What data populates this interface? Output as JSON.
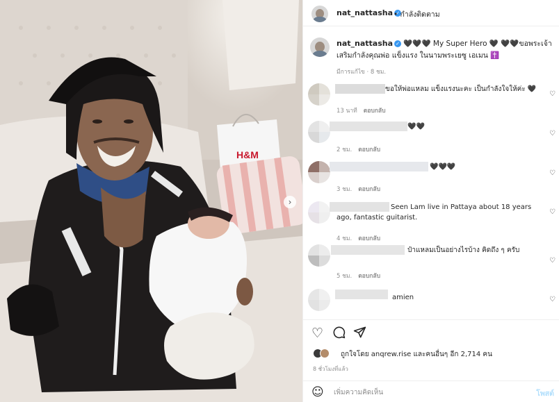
{
  "header": {
    "username": "nat_nattasha",
    "follow_status": "• กำลังติดตาม"
  },
  "caption": {
    "username": "nat_nattasha",
    "text": "🖤🖤🖤 My Super Hero 🖤 🖤🖤ขอพระเจ้า เสริมกำลังคุณพ่อ แข็งแรง ในนามพระเยซู เอเมน ✝️",
    "meta": "มีการแก้ไข · 8 ชม."
  },
  "photo": {
    "shopping_bag_text": "H&M",
    "next_icon": "chevron-right-icon"
  },
  "comments": [
    {
      "text": "ขอให้พ่อแหลม แข็งแรงนะคะ เป็นกำลังใจให้ค่ะ 🖤",
      "time": "13 นาที",
      "reply": "ตอบกลับ"
    },
    {
      "text": "🖤🖤",
      "time": "2 ชม.",
      "reply": "ตอบกลับ"
    },
    {
      "text": "🖤🖤🖤",
      "time": "3 ชม.",
      "reply": "ตอบกลับ"
    },
    {
      "text": "Seen Lam live in Pattaya about 18 years ago, fantastic guitarist.",
      "time": "4 ชม.",
      "reply": "ตอบกลับ"
    },
    {
      "text": "ป๋าแหลมเป็นอย่างไรบ้าง คิดถึง ๆ ครับ",
      "time": "5 ชม.",
      "reply": "ตอบกลับ"
    },
    {
      "text": "amien",
      "time": "",
      "reply": ""
    }
  ],
  "actions": {
    "like_icon": "heart-icon",
    "comment_icon": "comment-icon",
    "share_icon": "send-icon"
  },
  "likes": {
    "text": "ถูกใจโดย anqrew.rise และคนอื่นๆ อีก 2,714 คน"
  },
  "timestamp": "8 ชั่วโมงที่แล้ว",
  "add_comment": {
    "placeholder": "เพิ่มความคิดเห็น",
    "post_label": "โพสต์"
  },
  "colors": {
    "accent": "#3897f0",
    "post_disabled": "#b2dffc",
    "secondary_text": "#8e8e8e"
  }
}
